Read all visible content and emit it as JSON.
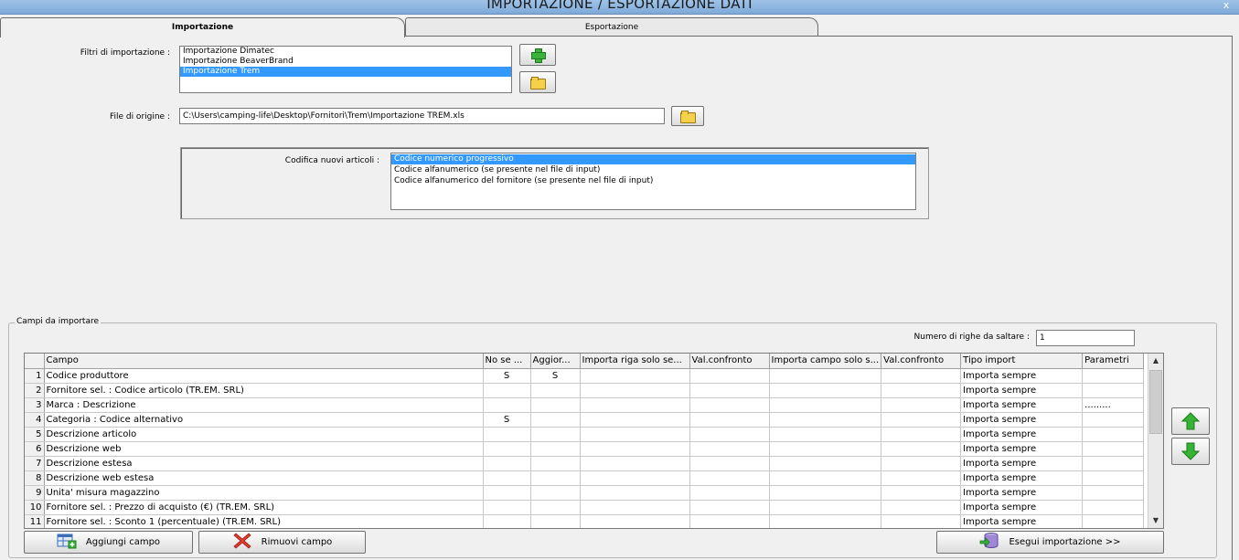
{
  "window": {
    "title": "IMPORTAZIONE / ESPORTAZIONE DATI",
    "close_glyph": "x"
  },
  "tabs": [
    {
      "label": "Importazione",
      "active": true
    },
    {
      "label": "Esportazione",
      "active": false
    }
  ],
  "import_filters": {
    "label": "Filtri di importazione :",
    "items": [
      "Importazione Dimatec",
      "Importazione BeaverBrand",
      "Importazione Trem"
    ],
    "selected_index": 2,
    "add_icon": "plus-icon",
    "open_icon": "folder-icon"
  },
  "source_file": {
    "label": "File di origine :",
    "value": "C:\\Users\\camping-life\\Desktop\\Fornitori\\Trem\\Importazione TREM.xls",
    "browse_icon": "folder-icon"
  },
  "coding": {
    "label": "Codifica nuovi articoli :",
    "items": [
      "Codice numerico progressivo",
      "Codice alfanumerico (se presente nel file di input)",
      "Codice alfanumerico del fornitore (se presente nel file di input)"
    ],
    "selected_index": 0
  },
  "fields_group": {
    "legend": "Campi da importare",
    "skip_rows_label": "Numero di righe da saltare :",
    "skip_rows_value": "1"
  },
  "grid": {
    "columns": [
      "Campo",
      "No se ...",
      "Aggior...",
      "Importa riga solo se...",
      "Val.confronto",
      "Importa campo solo s...",
      "Val.confronto",
      "Tipo import",
      "Parametri"
    ],
    "rows": [
      {
        "n": "1",
        "campo": "Codice produttore",
        "nose": "S",
        "agg": "S",
        "tipo": "Importa sempre",
        "param": ""
      },
      {
        "n": "2",
        "campo": "Fornitore sel. : Codice articolo (TR.EM. SRL)",
        "nose": "",
        "agg": "",
        "tipo": "Importa sempre",
        "param": ""
      },
      {
        "n": "3",
        "campo": "Marca : Descrizione",
        "nose": "",
        "agg": "",
        "tipo": "Importa sempre",
        "param": "........."
      },
      {
        "n": "4",
        "campo": "Categoria : Codice alternativo",
        "nose": "S",
        "agg": "",
        "tipo": "Importa sempre",
        "param": ""
      },
      {
        "n": "5",
        "campo": "Descrizione articolo",
        "nose": "",
        "agg": "",
        "tipo": "Importa sempre",
        "param": ""
      },
      {
        "n": "6",
        "campo": "Descrizione web",
        "nose": "",
        "agg": "",
        "tipo": "Importa sempre",
        "param": ""
      },
      {
        "n": "7",
        "campo": "Descrizione estesa",
        "nose": "",
        "agg": "",
        "tipo": "Importa sempre",
        "param": ""
      },
      {
        "n": "8",
        "campo": "Descrizione web estesa",
        "nose": "",
        "agg": "",
        "tipo": "Importa sempre",
        "param": ""
      },
      {
        "n": "9",
        "campo": "Unita' misura magazzino",
        "nose": "",
        "agg": "",
        "tipo": "Importa sempre",
        "param": ""
      },
      {
        "n": "10",
        "campo": "Fornitore sel. : Prezzo di acquisto (€) (TR.EM. SRL)",
        "nose": "",
        "agg": "",
        "tipo": "Importa sempre",
        "param": ""
      },
      {
        "n": "11",
        "campo": "Fornitore sel. : Sconto 1 (percentuale) (TR.EM. SRL)",
        "nose": "",
        "agg": "",
        "tipo": "Importa sempre",
        "param": ""
      }
    ]
  },
  "buttons": {
    "add_field": "Aggiungi campo",
    "remove_field": "Rimuovi campo",
    "run_import": "Esegui importazione >>"
  },
  "icons": {
    "add_field": "table-add-icon",
    "remove_field": "red-x-icon",
    "run_import": "database-import-icon",
    "move_up": "green-arrow-up-icon",
    "move_down": "green-arrow-down-icon"
  }
}
